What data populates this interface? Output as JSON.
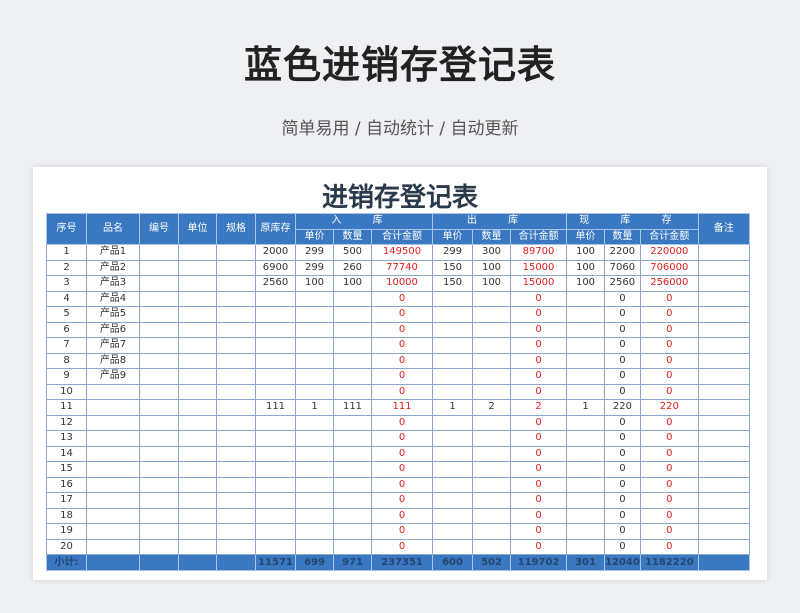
{
  "title": "蓝色进销存登记表",
  "subtitle": "简单易用 / 自动统计 / 自动更新",
  "sheet_title": "进销存登记表",
  "headers": {
    "seq": "序号",
    "name": "品名",
    "code": "编号",
    "unit": "单位",
    "spec": "规格",
    "orig_stock": "原库存",
    "in": "入 库",
    "out": "出 库",
    "stock": "现 库 存",
    "remark": "备注",
    "price": "单价",
    "qty": "数量",
    "total": "合计金额"
  },
  "rows": [
    {
      "seq": "1",
      "name": "产品1",
      "orig": "2000",
      "in_p": "299",
      "in_q": "500",
      "in_t": "149500",
      "out_p": "299",
      "out_q": "300",
      "out_t": "89700",
      "st_p": "100",
      "st_q": "2200",
      "st_t": "220000"
    },
    {
      "seq": "2",
      "name": "产品2",
      "orig": "6900",
      "in_p": "299",
      "in_q": "260",
      "in_t": "77740",
      "out_p": "150",
      "out_q": "100",
      "out_t": "15000",
      "st_p": "100",
      "st_q": "7060",
      "st_t": "706000"
    },
    {
      "seq": "3",
      "name": "产品3",
      "orig": "2560",
      "in_p": "100",
      "in_q": "100",
      "in_t": "10000",
      "out_p": "150",
      "out_q": "100",
      "out_t": "15000",
      "st_p": "100",
      "st_q": "2560",
      "st_t": "256000"
    },
    {
      "seq": "4",
      "name": "产品4",
      "orig": "",
      "in_p": "",
      "in_q": "",
      "in_t": "0",
      "out_p": "",
      "out_q": "",
      "out_t": "0",
      "st_p": "",
      "st_q": "0",
      "st_t": "0"
    },
    {
      "seq": "5",
      "name": "产品5",
      "orig": "",
      "in_p": "",
      "in_q": "",
      "in_t": "0",
      "out_p": "",
      "out_q": "",
      "out_t": "0",
      "st_p": "",
      "st_q": "0",
      "st_t": "0"
    },
    {
      "seq": "6",
      "name": "产品6",
      "orig": "",
      "in_p": "",
      "in_q": "",
      "in_t": "0",
      "out_p": "",
      "out_q": "",
      "out_t": "0",
      "st_p": "",
      "st_q": "0",
      "st_t": "0"
    },
    {
      "seq": "7",
      "name": "产品7",
      "orig": "",
      "in_p": "",
      "in_q": "",
      "in_t": "0",
      "out_p": "",
      "out_q": "",
      "out_t": "0",
      "st_p": "",
      "st_q": "0",
      "st_t": "0"
    },
    {
      "seq": "8",
      "name": "产品8",
      "orig": "",
      "in_p": "",
      "in_q": "",
      "in_t": "0",
      "out_p": "",
      "out_q": "",
      "out_t": "0",
      "st_p": "",
      "st_q": "0",
      "st_t": "0"
    },
    {
      "seq": "9",
      "name": "产品9",
      "orig": "",
      "in_p": "",
      "in_q": "",
      "in_t": "0",
      "out_p": "",
      "out_q": "",
      "out_t": "0",
      "st_p": "",
      "st_q": "0",
      "st_t": "0"
    },
    {
      "seq": "10",
      "name": "",
      "orig": "",
      "in_p": "",
      "in_q": "",
      "in_t": "0",
      "out_p": "",
      "out_q": "",
      "out_t": "0",
      "st_p": "",
      "st_q": "0",
      "st_t": "0"
    },
    {
      "seq": "11",
      "name": "",
      "orig": "111",
      "in_p": "1",
      "in_q": "111",
      "in_t": "111",
      "out_p": "1",
      "out_q": "2",
      "out_t": "2",
      "st_p": "1",
      "st_q": "220",
      "st_t": "220"
    },
    {
      "seq": "12",
      "name": "",
      "orig": "",
      "in_p": "",
      "in_q": "",
      "in_t": "0",
      "out_p": "",
      "out_q": "",
      "out_t": "0",
      "st_p": "",
      "st_q": "0",
      "st_t": "0"
    },
    {
      "seq": "13",
      "name": "",
      "orig": "",
      "in_p": "",
      "in_q": "",
      "in_t": "0",
      "out_p": "",
      "out_q": "",
      "out_t": "0",
      "st_p": "",
      "st_q": "0",
      "st_t": "0"
    },
    {
      "seq": "14",
      "name": "",
      "orig": "",
      "in_p": "",
      "in_q": "",
      "in_t": "0",
      "out_p": "",
      "out_q": "",
      "out_t": "0",
      "st_p": "",
      "st_q": "0",
      "st_t": "0"
    },
    {
      "seq": "15",
      "name": "",
      "orig": "",
      "in_p": "",
      "in_q": "",
      "in_t": "0",
      "out_p": "",
      "out_q": "",
      "out_t": "0",
      "st_p": "",
      "st_q": "0",
      "st_t": "0"
    },
    {
      "seq": "16",
      "name": "",
      "orig": "",
      "in_p": "",
      "in_q": "",
      "in_t": "0",
      "out_p": "",
      "out_q": "",
      "out_t": "0",
      "st_p": "",
      "st_q": "0",
      "st_t": "0"
    },
    {
      "seq": "17",
      "name": "",
      "orig": "",
      "in_p": "",
      "in_q": "",
      "in_t": "0",
      "out_p": "",
      "out_q": "",
      "out_t": "0",
      "st_p": "",
      "st_q": "0",
      "st_t": "0"
    },
    {
      "seq": "18",
      "name": "",
      "orig": "",
      "in_p": "",
      "in_q": "",
      "in_t": "0",
      "out_p": "",
      "out_q": "",
      "out_t": "0",
      "st_p": "",
      "st_q": "0",
      "st_t": "0"
    },
    {
      "seq": "19",
      "name": "",
      "orig": "",
      "in_p": "",
      "in_q": "",
      "in_t": "0",
      "out_p": "",
      "out_q": "",
      "out_t": "0",
      "st_p": "",
      "st_q": "0",
      "st_t": "0"
    },
    {
      "seq": "20",
      "name": "",
      "orig": "",
      "in_p": "",
      "in_q": "",
      "in_t": "0",
      "out_p": "",
      "out_q": "",
      "out_t": "0",
      "st_p": "",
      "st_q": "0",
      "st_t": "0"
    }
  ],
  "totals": {
    "label": "小计:",
    "orig": "11571",
    "in_p": "699",
    "in_q": "971",
    "in_t": "237351",
    "out_p": "600",
    "out_q": "502",
    "out_t": "119702",
    "st_p": "301",
    "st_q": "12040",
    "st_t": "1182220"
  },
  "colors": {
    "header_blue": "#3a78c2",
    "amount_red": "#e02020",
    "grid": "#8aa7cf"
  }
}
